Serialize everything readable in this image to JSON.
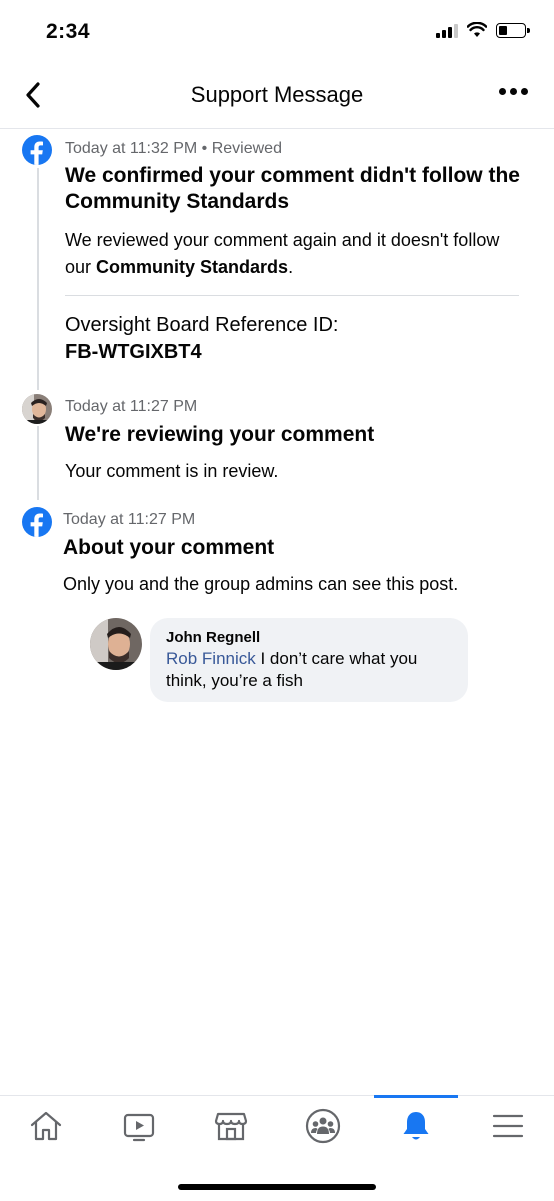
{
  "status_bar": {
    "time": "2:34"
  },
  "header": {
    "title": "Support Message",
    "back_icon": "chevron-left-icon",
    "more_icon": "more-dots-icon"
  },
  "timeline": [
    {
      "icon": "facebook-logo-icon",
      "meta": "Today at 11:32 PM • Reviewed",
      "title": "We confirmed your comment didn't follow the Community Standards",
      "body_prefix": "We reviewed your comment again and it doesn't follow our ",
      "body_bold": "Community Standards",
      "body_suffix": ".",
      "reference_label": "Oversight Board Reference ID:",
      "reference_id": "FB-WTGIXBT4"
    },
    {
      "icon": "user-avatar",
      "meta": "Today at 11:27 PM",
      "title": "We're reviewing your comment",
      "body": "Your comment is in review."
    },
    {
      "icon": "facebook-logo-icon",
      "meta": "Today at 11:27 PM",
      "title": "About your comment",
      "body": "Only you and the group admins can see this post."
    }
  ],
  "comment": {
    "author": "John Regnell",
    "mention": "Rob Finnick",
    "text": " I don’t care what you think, you’re a fish"
  },
  "bottom_nav": {
    "items": [
      "home-icon",
      "watch-icon",
      "marketplace-icon",
      "groups-icon",
      "notifications-icon",
      "menu-icon"
    ],
    "active": "notifications-icon"
  },
  "colors": {
    "accent": "#1877f2",
    "mention": "#385898",
    "meta": "#65676b",
    "bubble": "#f0f2f5"
  }
}
